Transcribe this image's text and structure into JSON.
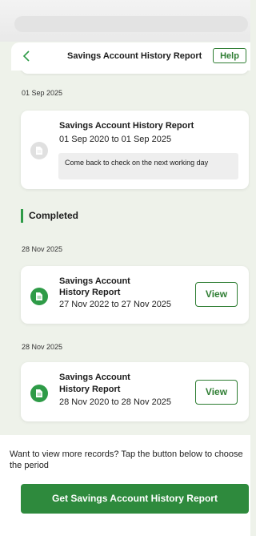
{
  "header": {
    "title": "Savings Account History Report",
    "help_label": "Help"
  },
  "pending": {
    "date": "01 Sep 2025",
    "title": "Savings Account History Report",
    "range": "01 Sep 2020 to 01 Sep 2025",
    "notice": "Come back to check on the next working day"
  },
  "completed": {
    "heading": "Completed",
    "items": [
      {
        "date": "28 Nov 2025",
        "title_line1": "Savings Account",
        "title_line2": "History Report",
        "range": "27 Nov 2022 to 27 Nov 2025",
        "view_label": "View"
      },
      {
        "date": "28 Nov 2025",
        "title_line1": "Savings Account",
        "title_line2": "History Report",
        "range": "28 Nov 2020 to 28 Nov 2025",
        "view_label": "View"
      }
    ]
  },
  "footer": {
    "prompt": "Want to view more records? Tap the button below to choose the period",
    "cta_label": "Get Savings Account History Report"
  },
  "colors": {
    "accent": "#2e8a3d",
    "background": "#eef2ea"
  },
  "icons": [
    "back-chevron-icon",
    "document-icon"
  ]
}
